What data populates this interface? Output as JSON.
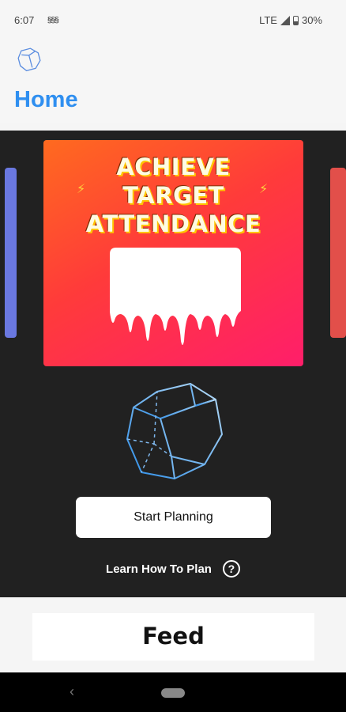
{
  "status_bar": {
    "time": "6:07",
    "notification": "§§§",
    "network": "LTE",
    "battery": "30%",
    "battery_level": 0.3
  },
  "header": {
    "title": "Home",
    "logo_icon": "octagon-logo-icon"
  },
  "banner": {
    "title_lines": [
      "ACHIEVE",
      "TARGET",
      "ATTENDANCE"
    ],
    "colors": [
      "#ff6a1f",
      "#ff1e6a"
    ]
  },
  "actions": {
    "start_label": "Start Planning",
    "learn_label": "Learn How To Plan",
    "help_icon": "question-circle-icon"
  },
  "feed": {
    "title": "Feed"
  },
  "nav": {
    "back_icon": "chevron-left-icon",
    "home_icon": "home-pill-icon"
  },
  "colors": {
    "accent": "#2f8ff0",
    "hero_bg": "#212121"
  }
}
